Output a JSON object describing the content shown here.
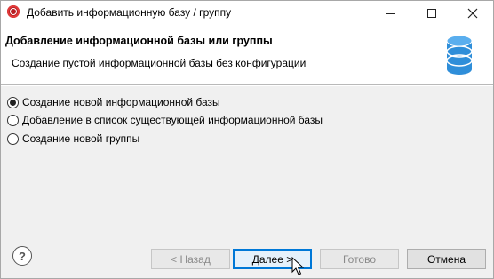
{
  "window": {
    "title": "Добавить информационную базу / группу"
  },
  "header": {
    "title": "Добавление информационной базы или группы",
    "subtitle": "Создание пустой информационной базы без конфигурации",
    "icon": "database-icon"
  },
  "options": [
    {
      "label": "Создание новой информационной базы",
      "checked": true
    },
    {
      "label": "Добавление в список существующей информационной базы",
      "checked": false
    },
    {
      "label": "Создание новой группы",
      "checked": false
    }
  ],
  "buttons": {
    "help": "?",
    "back": "< Назад",
    "next": "Далее >",
    "finish": "Готово",
    "cancel": "Отмена"
  },
  "colors": {
    "accent": "#0078d7",
    "db_icon": "#2f8ed9"
  }
}
